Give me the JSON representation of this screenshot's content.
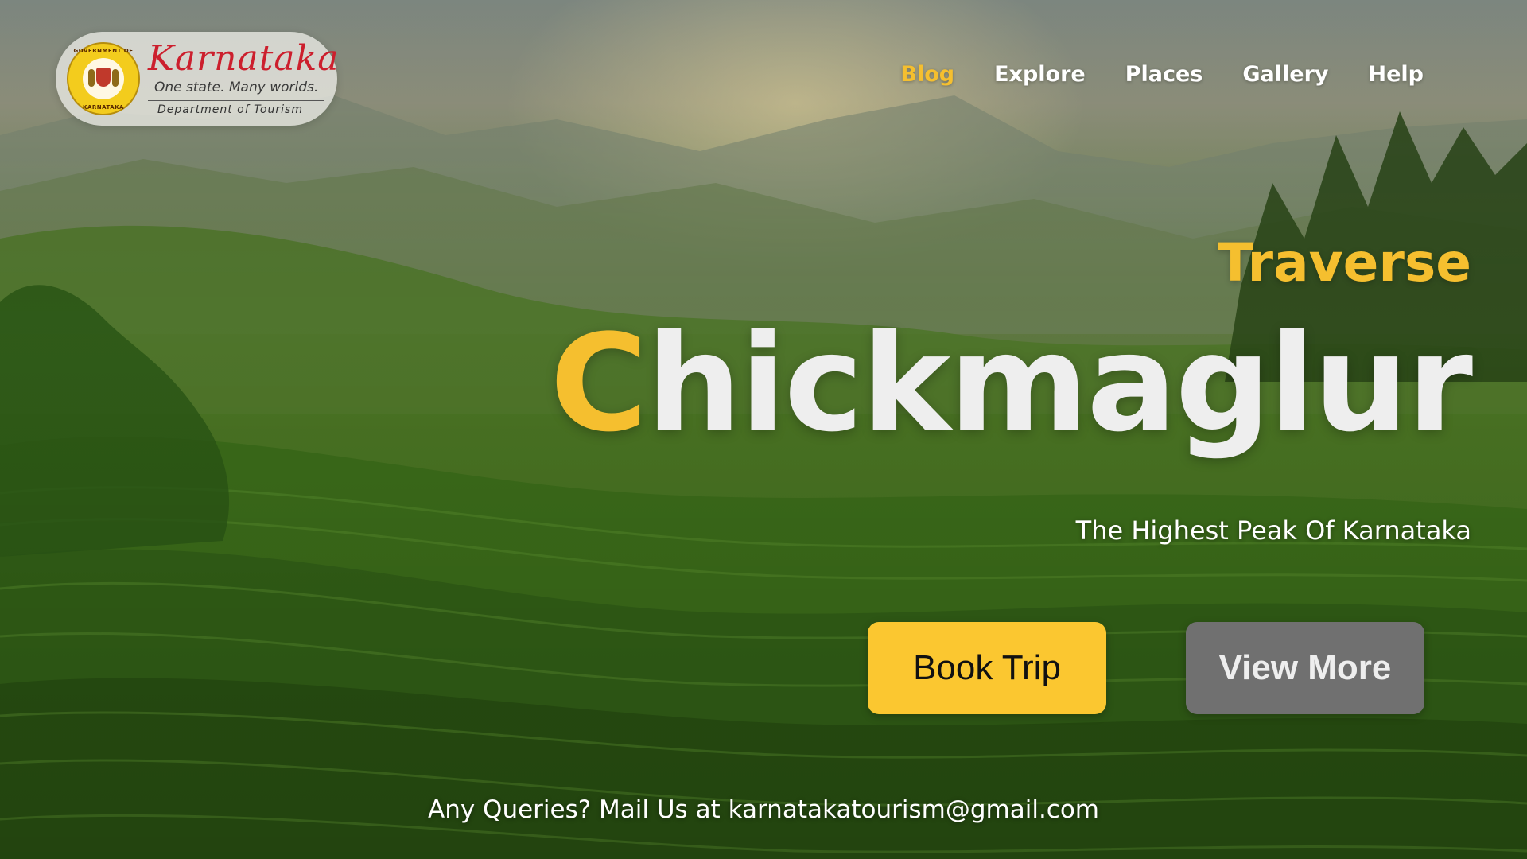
{
  "brand": {
    "title": "Karnataka",
    "tagline": "One state. Many worlds.",
    "department": "Department of Tourism",
    "emblem_top_text": "GOVERNMENT OF",
    "emblem_bottom_text": "KARNATAKA"
  },
  "nav": {
    "items": [
      {
        "label": "Blog",
        "active": true
      },
      {
        "label": "Explore",
        "active": false
      },
      {
        "label": "Places",
        "active": false
      },
      {
        "label": "Gallery",
        "active": false
      },
      {
        "label": "Help",
        "active": false
      }
    ]
  },
  "hero": {
    "kicker": "Traverse",
    "title_first_letter": "C",
    "title_rest": "hickmaglur",
    "subtitle": "The Highest Peak Of Karnataka"
  },
  "buttons": {
    "book_label": "Book Trip",
    "view_label": "View More"
  },
  "footer": {
    "contact_text": "Any Queries? Mail Us at karnatakatourism@gmail.com"
  },
  "colors": {
    "accent": "#f5bf2f",
    "book_button": "#fbc730",
    "view_button": "#707070",
    "title_text": "#eeeeee"
  },
  "icons": {
    "emblem": "government-emblem"
  }
}
